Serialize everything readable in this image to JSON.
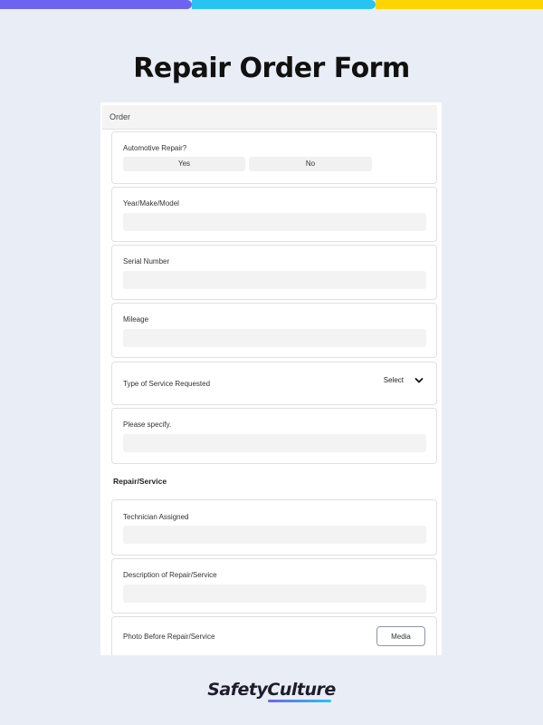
{
  "colors": {
    "bar_purple": "#6e63f0",
    "bar_cyan": "#27c4f2",
    "bar_yellow": "#ffd500",
    "background": "#e9eef6",
    "logo_underline": "#6e63f0"
  },
  "page": {
    "title": "Repair Order Form"
  },
  "form": {
    "section_order": "Order",
    "automotive": {
      "label": "Automotive Repair?",
      "yes": "Yes",
      "no": "No"
    },
    "year_make_model": {
      "label": "Year/Make/Model"
    },
    "serial_number": {
      "label": "Serial Number"
    },
    "mileage": {
      "label": "Mileage"
    },
    "service_type": {
      "label": "Type of Service Requested",
      "select_value": "Select",
      "icon": "chevron-down-icon"
    },
    "please_specify": {
      "label": "Please specify."
    },
    "section_repair": "Repair/Service",
    "technician": {
      "label": "Technician Assigned"
    },
    "description": {
      "label": "Description of Repair/Service"
    },
    "photo_before": {
      "label": "Photo Before Repair/Service",
      "button": "Media"
    }
  },
  "footer": {
    "logo_text": "SafetyCulture"
  }
}
